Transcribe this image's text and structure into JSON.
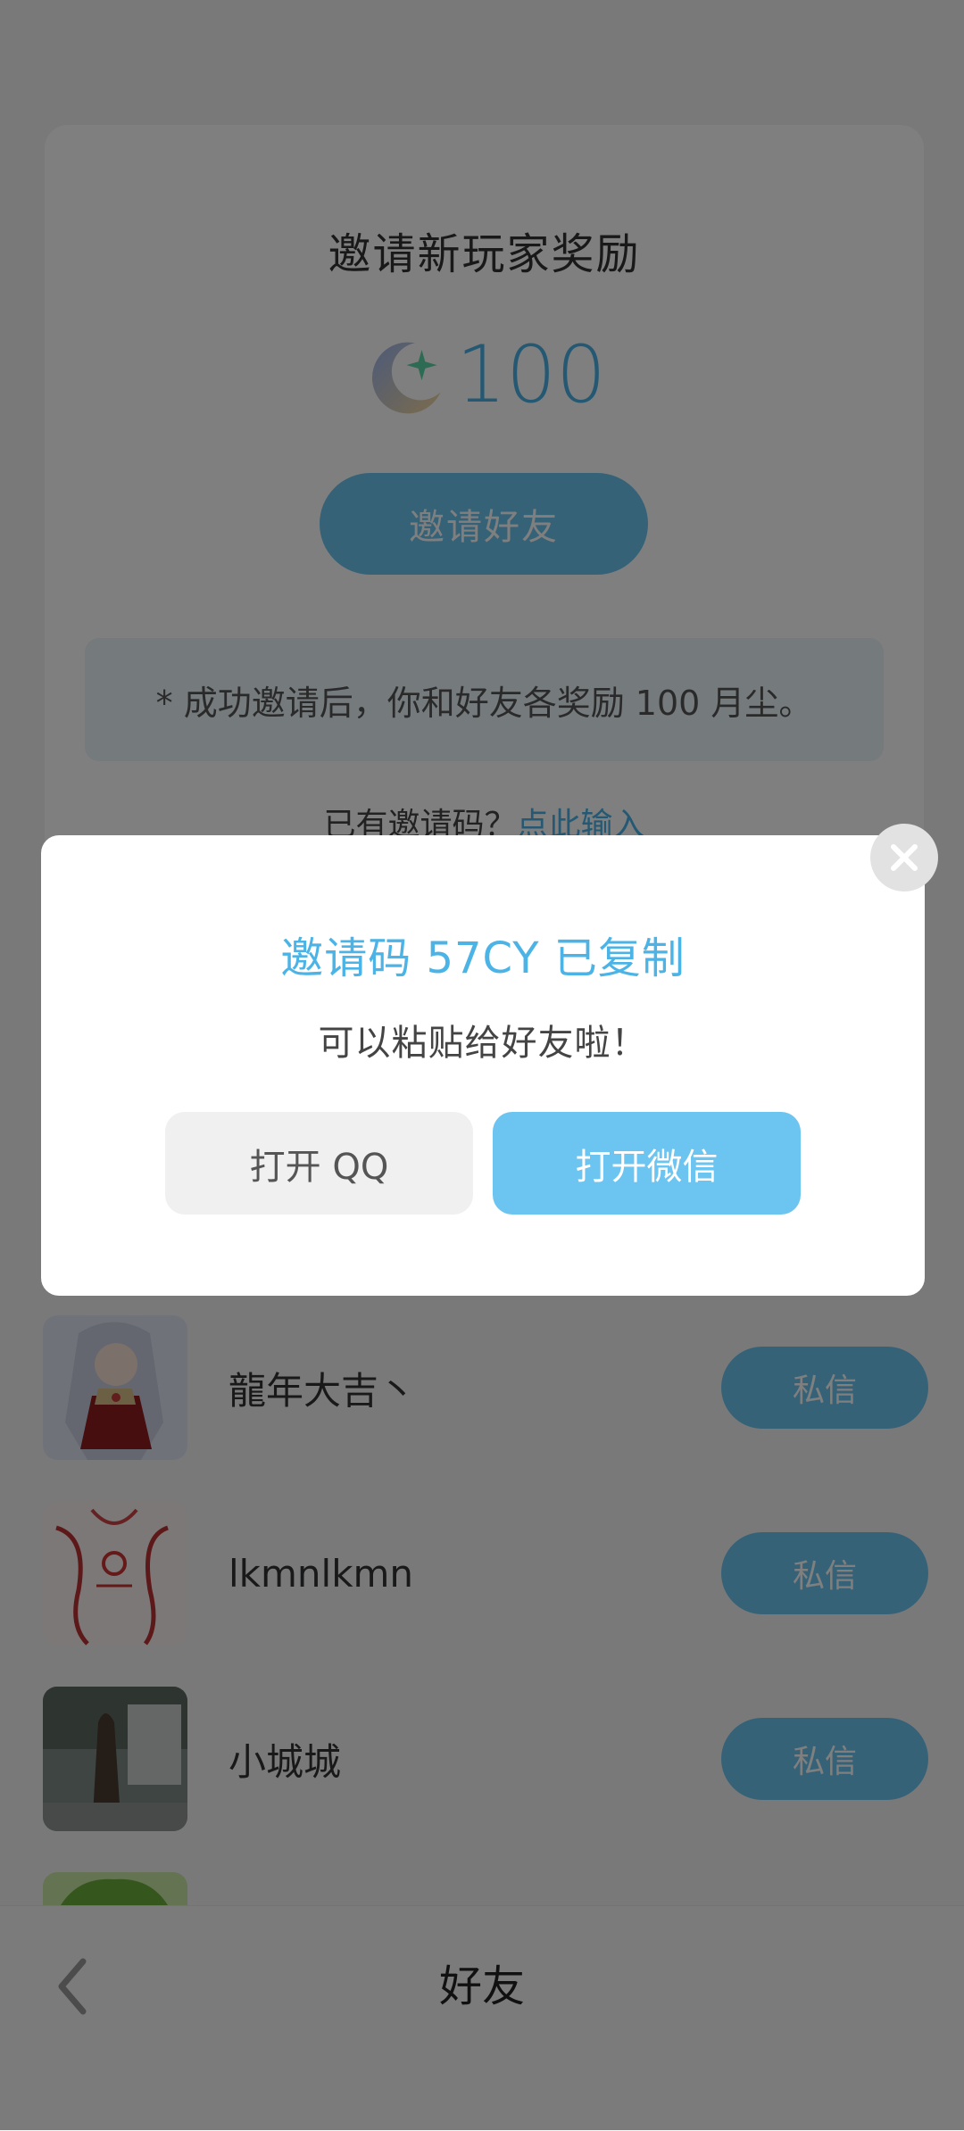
{
  "invite_card": {
    "title": "邀请新玩家奖励",
    "reward_amount": "100",
    "invite_button": "邀请好友",
    "tip": "* 成功邀请后，你和好友各奖励 100 月尘。",
    "have_code_prefix": "已有邀请码？",
    "have_code_link": "点此输入"
  },
  "friends": [
    {
      "name": "龍年大吉丶",
      "button": "私信",
      "avatar": "anime-girl-avatar"
    },
    {
      "name": "lkmnlkmn",
      "button": "私信",
      "avatar": "sketch-avatar"
    },
    {
      "name": "小城城",
      "button": "私信",
      "avatar": "tree-photo-avatar"
    }
  ],
  "bottom_bar": {
    "title": "好友",
    "back_icon": "chevron-left-icon"
  },
  "modal": {
    "title": "邀请码 57CY 已复制",
    "subtitle": "可以粘贴给好友啦！",
    "qq_button": "打开 QQ",
    "wechat_button": "打开微信",
    "close_icon": "close-icon"
  },
  "colors": {
    "accent": "#6cc5f0",
    "accent_text": "#4bb3e6",
    "overlay": "rgba(0,0,0,0.5)"
  }
}
